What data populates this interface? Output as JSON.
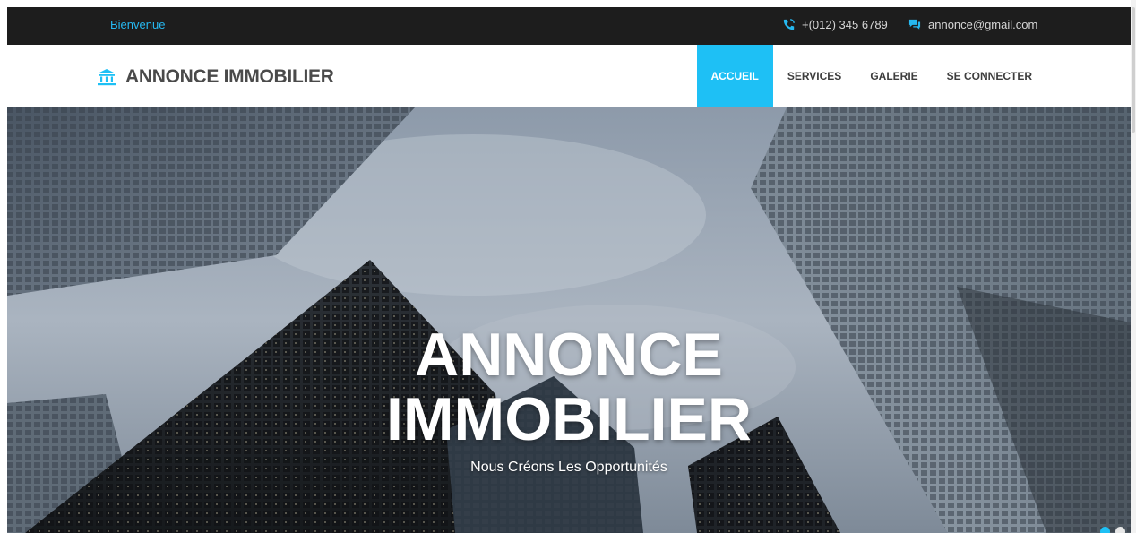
{
  "topbar": {
    "welcome": "Bienvenue",
    "phone": "+(012) 345 6789",
    "email": "annonce@gmail.com"
  },
  "brand": {
    "name": "ANNONCE IMMOBILIER",
    "icon": "bank-icon"
  },
  "menu": {
    "items": [
      {
        "label": "ACCUEIL",
        "active": true
      },
      {
        "label": "SERVICES",
        "active": false
      },
      {
        "label": "GALERIE",
        "active": false
      },
      {
        "label": "SE CONNECTER",
        "active": false
      }
    ]
  },
  "hero": {
    "title_line1": "ANNONCE",
    "title_line2": "IMMOBILIER",
    "subtitle": "Nous Créons Les Opportunités",
    "slides_count": 2,
    "active_slide": 1
  },
  "colors": {
    "accent": "#1ec0f5",
    "topbar_bg": "#1d1d1d",
    "brand_text": "#4a4a4a"
  },
  "icons": [
    "phone-icon",
    "chat-icon",
    "bank-icon"
  ]
}
